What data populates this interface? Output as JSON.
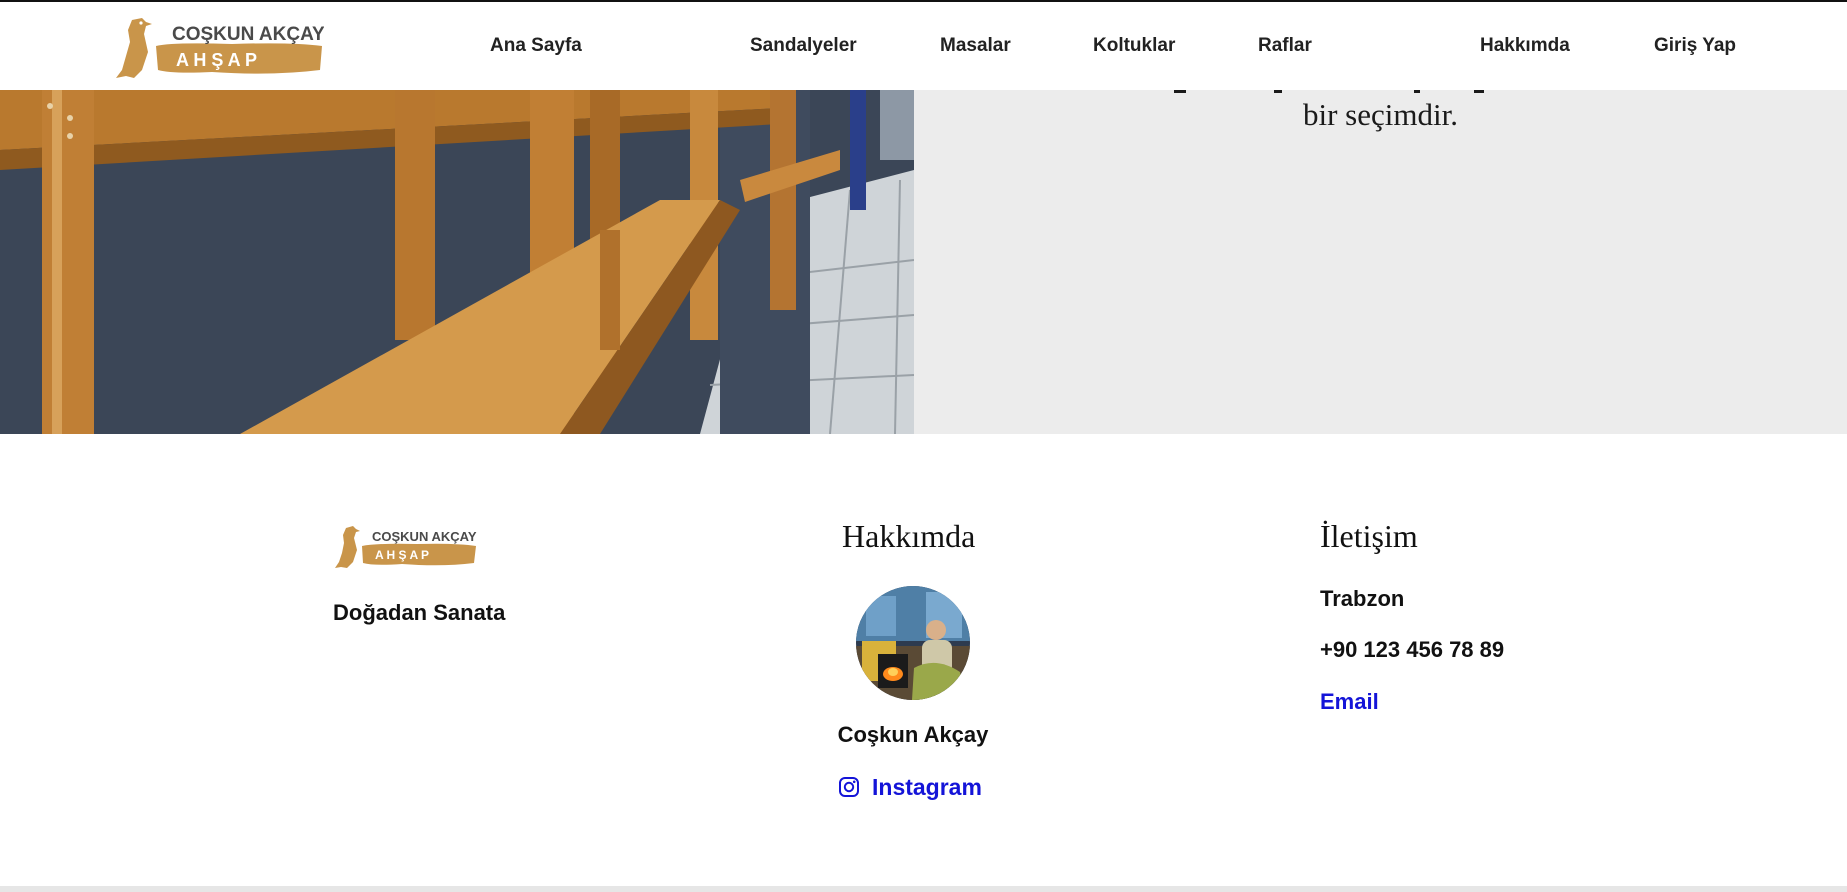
{
  "brand": {
    "logo_line1": "COŞKUN AKÇAY",
    "logo_line2": "A H Ş A P",
    "accent_color": "#c9954a"
  },
  "nav": {
    "items": [
      {
        "label": "Ana Sayfa"
      },
      {
        "label": "Sandalyeler"
      },
      {
        "label": "Masalar"
      },
      {
        "label": "Koltuklar"
      },
      {
        "label": "Raflar"
      },
      {
        "label": "Hakkımda"
      },
      {
        "label": "Giriş Yap"
      }
    ]
  },
  "hero": {
    "text_tail": "bir seçimdir."
  },
  "footer": {
    "tagline": "Doğadan Sanata",
    "about": {
      "title": "Hakkımda",
      "name": "Coşkun Akçay",
      "instagram_label": "Instagram",
      "instagram_icon": "instagram-icon"
    },
    "contact": {
      "title": "İletişim",
      "city": "Trabzon",
      "phone": "+90 123 456 78 89",
      "email_label": "Email"
    },
    "link_color": "#1414d8"
  }
}
